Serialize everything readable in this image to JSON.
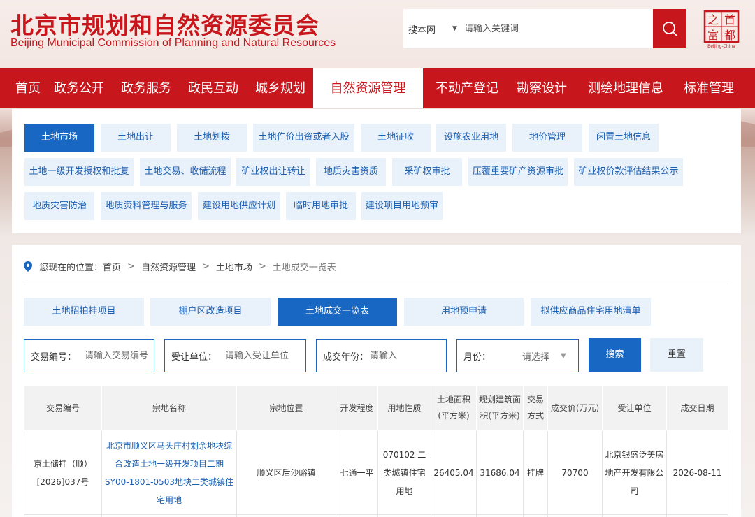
{
  "header": {
    "title_cn": "北京市规划和自然资源委员会",
    "title_en": "Beijing Municipal Commission of Planning and Natural Resources",
    "search_scope": "搜本网",
    "search_placeholder": "请输入关键词",
    "seal_chars": [
      "首",
      "之",
      "都",
      "富"
    ],
    "seal_en": "Beijing-China"
  },
  "nav": {
    "items": [
      {
        "label": "首页"
      },
      {
        "label": "政务公开"
      },
      {
        "label": "政务服务"
      },
      {
        "label": "政民互动"
      },
      {
        "label": "城乡规划"
      },
      {
        "label": "自然资源管理"
      },
      {
        "label": "不动产登记"
      },
      {
        "label": "勘察设计"
      },
      {
        "label": "测绘地理信息"
      },
      {
        "label": "标准管理"
      }
    ],
    "active": "自然资源管理"
  },
  "submenu": {
    "items": [
      {
        "label": "土地市场"
      },
      {
        "label": "土地出让"
      },
      {
        "label": "土地划拨"
      },
      {
        "label": "土地作价出资或者入股"
      },
      {
        "label": "土地征收"
      },
      {
        "label": "设施农业用地"
      },
      {
        "label": "地价管理"
      },
      {
        "label": "闲置土地信息"
      },
      {
        "label": "土地一级开发授权和批复"
      },
      {
        "label": "土地交易、收储流程"
      },
      {
        "label": "矿业权出让转让"
      },
      {
        "label": "地质灾害资质"
      },
      {
        "label": "采矿权审批"
      },
      {
        "label": "压覆重要矿产资源审批"
      },
      {
        "label": "矿业权价款评估结果公示"
      },
      {
        "label": "地质灾害防治"
      },
      {
        "label": "地质资料管理与服务"
      },
      {
        "label": "建设用地供应计划"
      },
      {
        "label": "临时用地审批"
      },
      {
        "label": "建设项目用地预审"
      }
    ],
    "active": "土地市场"
  },
  "breadcrumb": {
    "prefix": "您现在的位置：",
    "items": [
      "首页",
      "自然资源管理",
      "土地市场"
    ],
    "current": "土地成交一览表"
  },
  "tabs": [
    {
      "label": "土地招拍挂项目"
    },
    {
      "label": "棚户区改造项目"
    },
    {
      "label": "土地成交一览表"
    },
    {
      "label": "用地预申请"
    },
    {
      "label": "拟供应商品住宅用地清单"
    }
  ],
  "active_tab": "土地成交一览表",
  "filters": {
    "trade_no": {
      "label": "交易编号：",
      "placeholder": "请输入交易编号"
    },
    "grantee": {
      "label": "受让单位：",
      "placeholder": "请输入受让单位"
    },
    "year": {
      "label": "成交年份：",
      "placeholder": "请输入"
    },
    "month": {
      "label": "月份：",
      "placeholder": "请选择"
    },
    "search_label": "搜索",
    "reset_label": "重置"
  },
  "table": {
    "headers": [
      "交易编号",
      "宗地名称",
      "宗地位置",
      "开发程度",
      "用地性质",
      "土地面积(平方米)",
      "规划建筑面积(平方米)",
      "交易方式",
      "成交价(万元)",
      "受让单位",
      "成交日期"
    ],
    "rows": [
      {
        "trade_no": "京土储挂（顺）[2026]037号",
        "parcel_name": "北京市顺义区马头庄村剩余地块综合改造土地一级开发项目二期SY00-1801-0503地块二类城镇住宅用地",
        "location": "顺义区后沙峪镇",
        "development": "七通一平",
        "land_use": "070102 二类城镇住宅用地",
        "land_area": "26405.04",
        "building_area": "31686.04",
        "method": "挂牌",
        "price": "70700",
        "grantee": "北京银盛泛美房地产开发有限公司",
        "date": "2026-08-11"
      }
    ]
  }
}
